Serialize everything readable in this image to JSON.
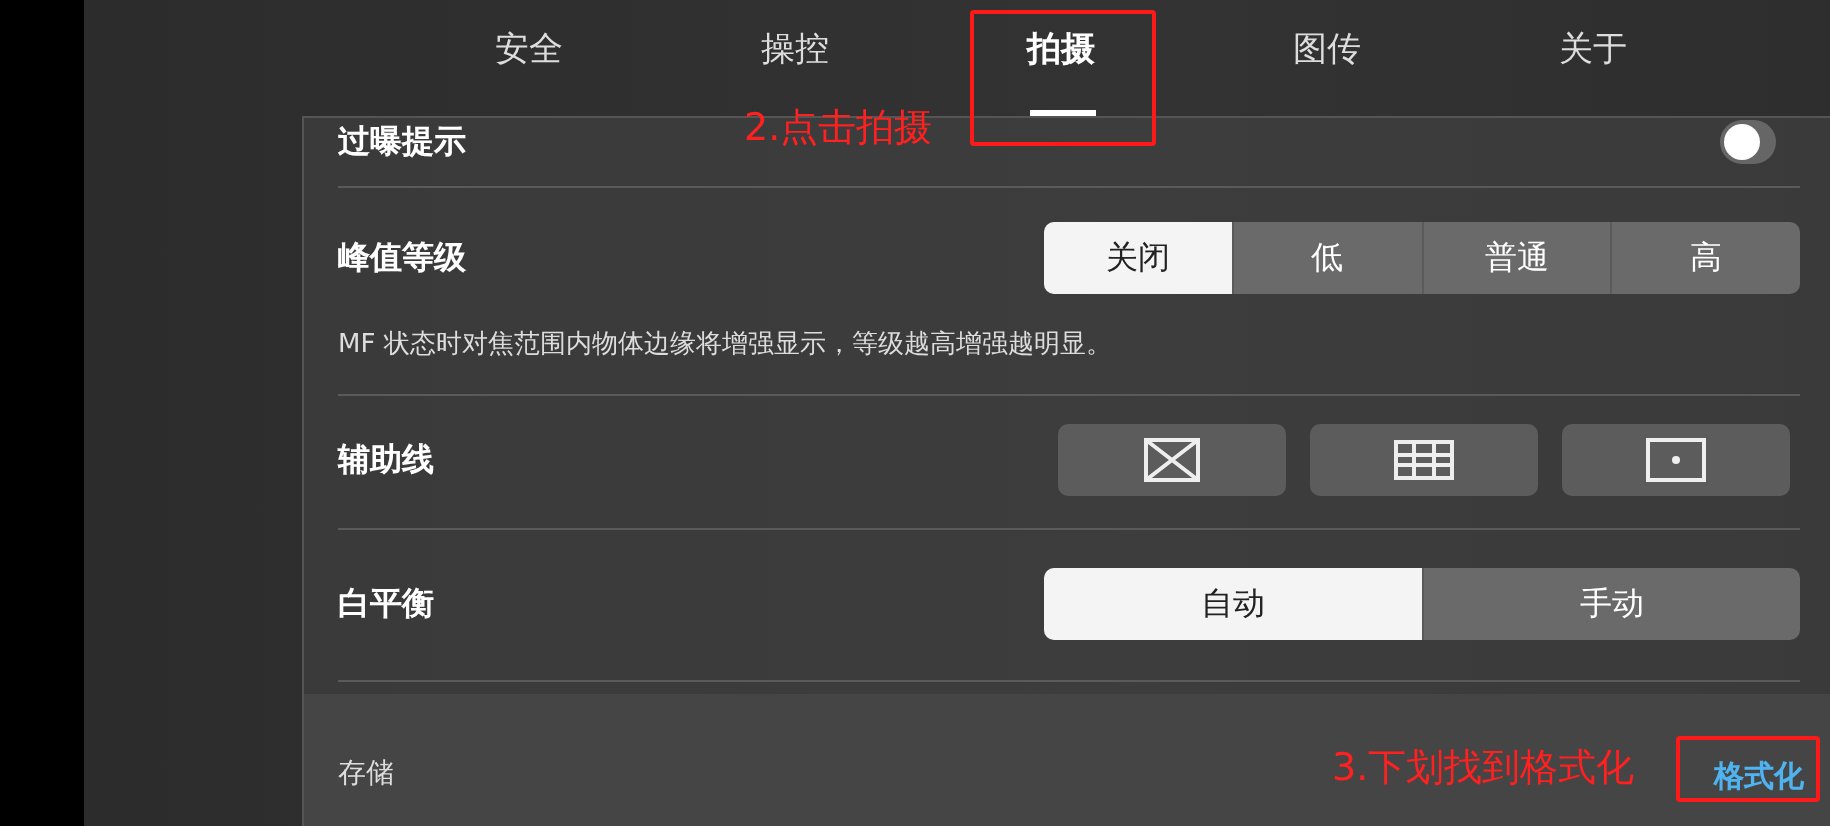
{
  "tabs": [
    {
      "label": "安全",
      "selected": false,
      "highlighted": false
    },
    {
      "label": "操控",
      "selected": false,
      "highlighted": false
    },
    {
      "label": "拍摄",
      "selected": true,
      "highlighted": true
    },
    {
      "label": "图传",
      "selected": false,
      "highlighted": false
    },
    {
      "label": "关于",
      "selected": false,
      "highlighted": false
    }
  ],
  "settings": [
    {
      "kind": "toggle",
      "label": "过曝提示",
      "on": false
    },
    {
      "kind": "segmented",
      "label": "峰值等级",
      "options": [
        {
          "label": "关闭",
          "selected": true
        },
        {
          "label": "低",
          "selected": false
        },
        {
          "label": "普通",
          "selected": false
        },
        {
          "label": "高",
          "selected": false
        }
      ],
      "description": "MF 状态时对焦范围内物体边缘将增强显示，等级越高增强越明显。"
    },
    {
      "kind": "icons",
      "label": "辅助线",
      "options": [
        {
          "selected": false
        },
        {
          "selected": false
        },
        {
          "selected": false
        }
      ]
    },
    {
      "kind": "segmented",
      "label": "白平衡",
      "options": [
        {
          "label": "自动",
          "selected": true
        },
        {
          "label": "手动",
          "selected": false
        }
      ]
    }
  ],
  "storage": {
    "label": "存储",
    "action": "格式化",
    "highlighted": true
  },
  "annotations": [
    {
      "text": "2.点击拍摄"
    },
    {
      "text": "3.下划找到格式化"
    }
  ]
}
